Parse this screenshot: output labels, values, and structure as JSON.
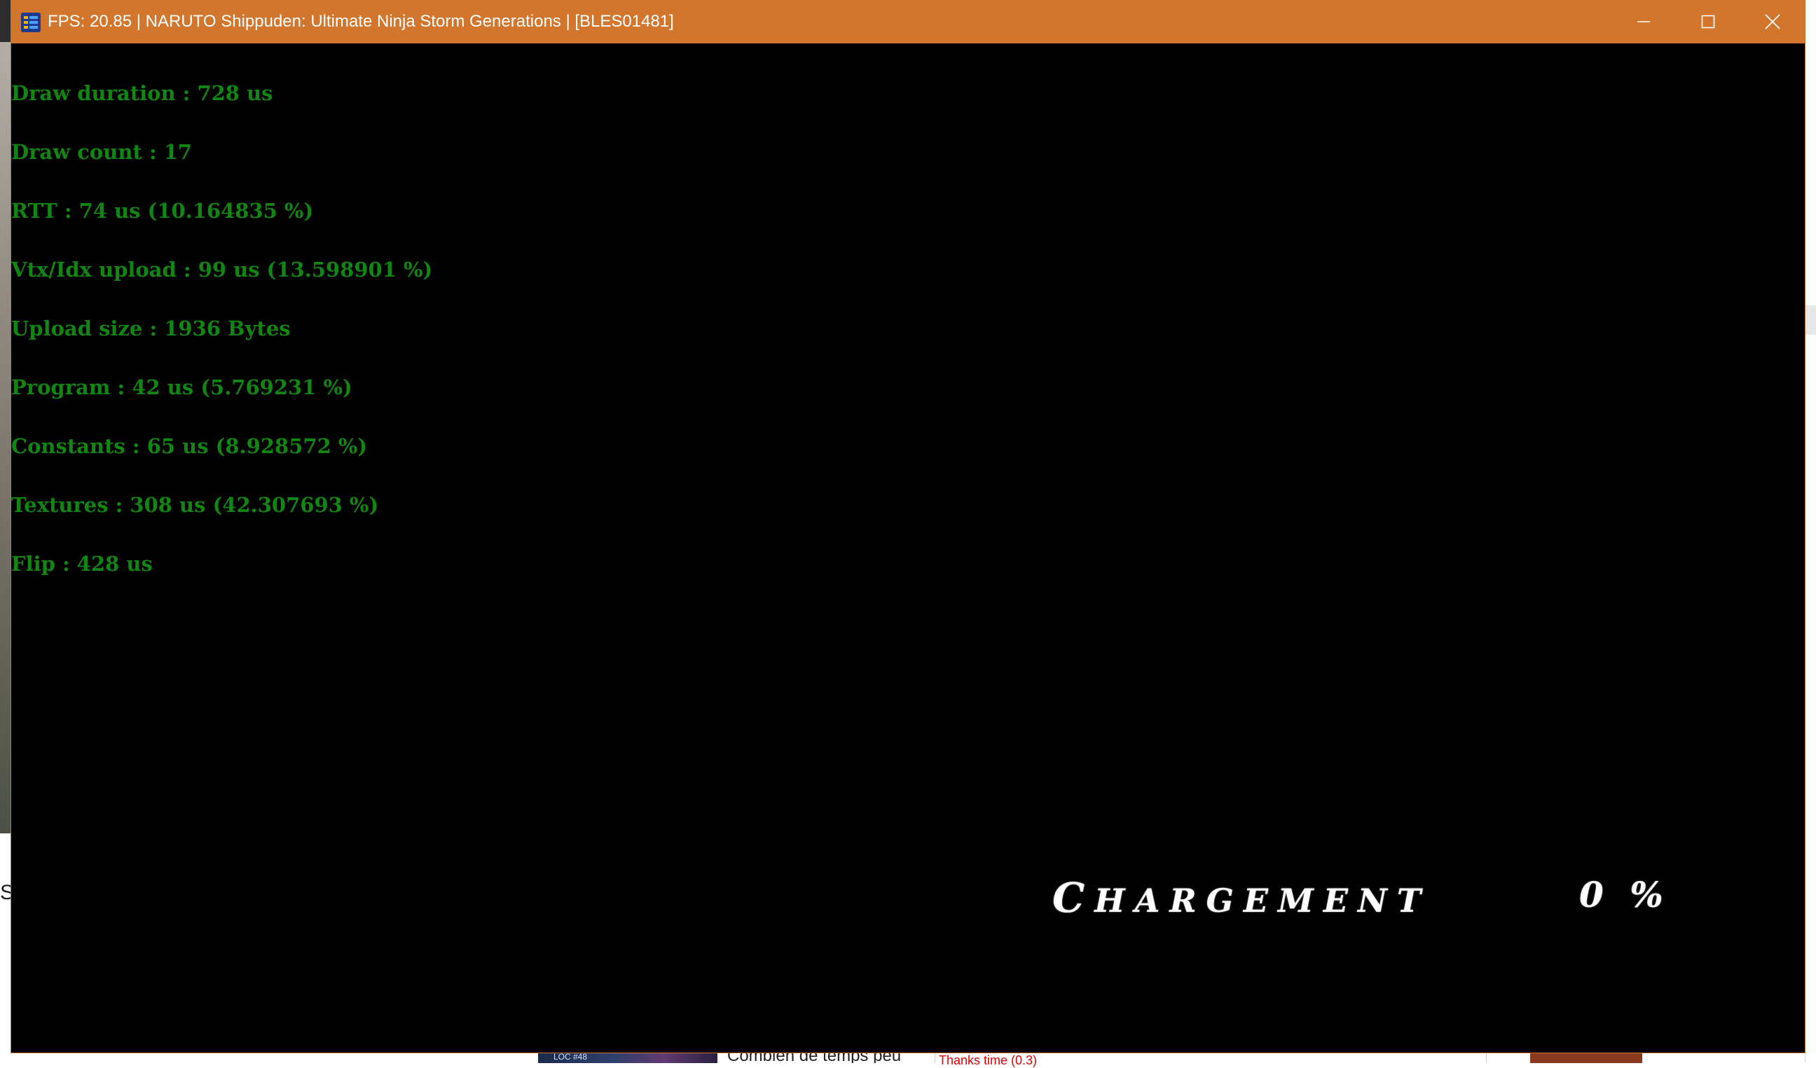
{
  "window": {
    "title": "FPS: 20.85 | NARUTO Shippuden: Ultimate Ninja Storm Generations | [BLES01481]",
    "controls": {
      "minimize_icon": "minimize-icon",
      "maximize_icon": "maximize-icon",
      "close_icon": "close-icon"
    },
    "app_icon": "rpcs3-icon",
    "titlebar_color": "#D2762E"
  },
  "perf_overlay": {
    "color": "#128612",
    "lines": [
      "Draw duration : 728 us",
      "Draw count : 17",
      "RTT : 74 us (10.164835 %)",
      "Vtx/Idx upload : 99 us (13.598901 %)",
      "Upload size : 1936 Bytes",
      "Program : 42 us (5.769231 %)",
      "Constants : 65 us (8.928572 %)",
      "Textures : 308 us (42.307693 %)",
      "Flip : 428 us"
    ]
  },
  "loading_screen": {
    "label_first": "C",
    "label_rest": "HARGEMENT",
    "percent": "0 %"
  },
  "background": {
    "left_letter": "S",
    "thumb_label": "LOC #48",
    "article_text": "Combien de temps peu",
    "panel_text": "Thanks time (0.3)"
  }
}
